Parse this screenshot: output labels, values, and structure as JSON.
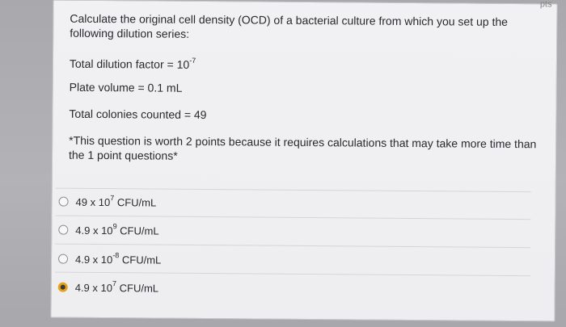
{
  "corner_label": "pts",
  "question": {
    "prompt": "Calculate the original cell density (OCD) of a bacterial culture from which you set up the following dilution series:",
    "dilution_label": "Total dilution factor = 10",
    "dilution_exp": "-7",
    "plate_volume": "Plate volume = 0.1 mL",
    "colonies": "Total colonies counted = 49",
    "note": "*This question is worth 2 points because it requires calculations that may take more time than the 1 point questions*"
  },
  "choices": [
    {
      "base": "49 x 10",
      "exp": "7",
      "unit": " CFU/mL",
      "selected": false
    },
    {
      "base": "4.9 x 10",
      "exp": "9",
      "unit": " CFU/mL",
      "selected": false
    },
    {
      "base": "4.9 x 10",
      "exp": "-8",
      "unit": " CFU/mL",
      "selected": false
    },
    {
      "base": "4.9 x 10",
      "exp": "7",
      "unit": " CFU/mL",
      "selected": true
    }
  ],
  "colors": {
    "selected_radio": "#e9a217",
    "page_background": "#b0b0b4",
    "card_background": "#f0f0f2"
  }
}
